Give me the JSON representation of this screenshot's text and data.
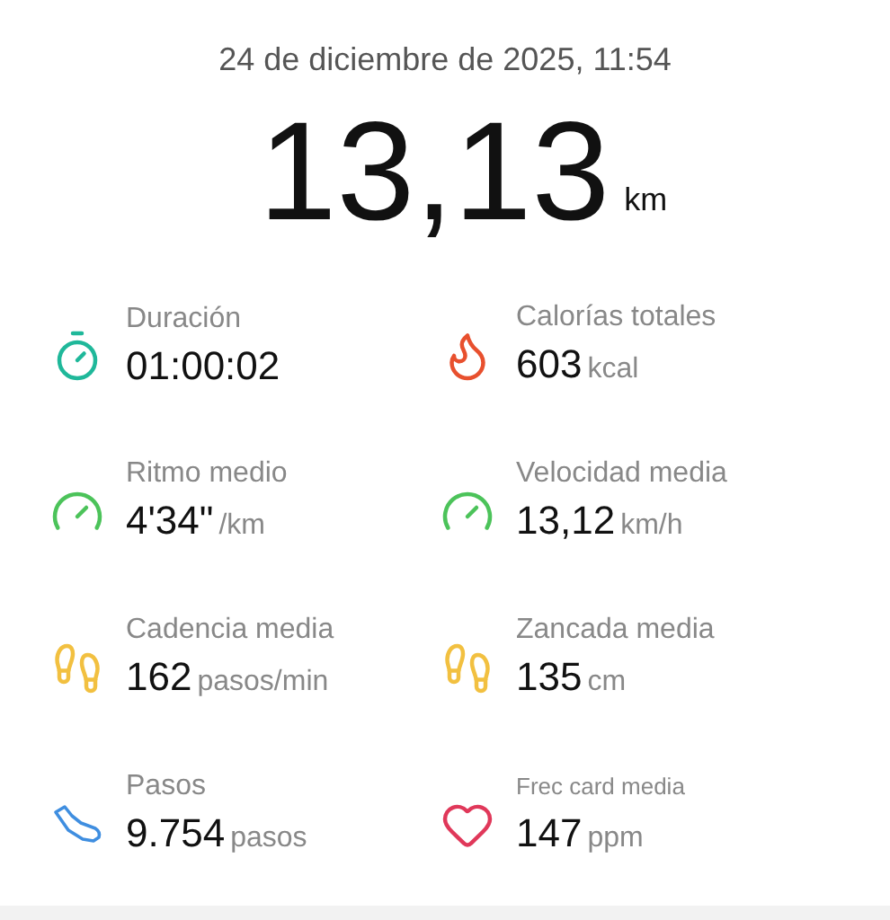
{
  "date": "24 de diciembre de 2025, 11:54",
  "distance": {
    "value": "13,13",
    "unit": "km"
  },
  "stats": [
    {
      "kind": "duration",
      "label": "Duración",
      "value": "01:00:02",
      "color": "#1fb89a"
    },
    {
      "kind": "calories",
      "label": "Calorías totales",
      "value": "603",
      "unit": "kcal",
      "color": "#e8502e"
    },
    {
      "kind": "pace",
      "label": "Ritmo medio",
      "value": "4'34\"",
      "unit": "/km",
      "color": "#4cc35a"
    },
    {
      "kind": "speed",
      "label": "Velocidad media",
      "value": "13,12",
      "unit": "km/h",
      "color": "#4cc35a"
    },
    {
      "kind": "cadence",
      "label": "Cadencia media",
      "value": "162",
      "unit": "pasos/min",
      "color": "#f2c040"
    },
    {
      "kind": "stride",
      "label": "Zancada media",
      "value": "135",
      "unit": "cm",
      "color": "#f2c040"
    },
    {
      "kind": "steps",
      "label": "Pasos",
      "value": "9.754",
      "unit": "pasos",
      "color": "#3f8ee0"
    },
    {
      "kind": "heart_rate",
      "label": "Frec card media",
      "value": "147",
      "unit": "ppm",
      "color": "#e0385a"
    }
  ]
}
